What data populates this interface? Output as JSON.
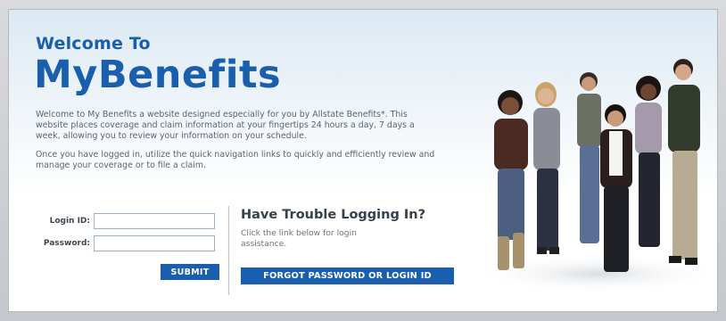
{
  "header": {
    "welcome_line": "Welcome To",
    "brand": "MyBenefits"
  },
  "intro": {
    "paragraph1": "Welcome to My Benefits a website designed especially for you by Allstate Benefits*. This website places coverage and claim information at your fingertips 24 hours a day, 7 days a week, allowing you to review your information on your schedule.",
    "paragraph2": "Once you have logged in, utilize the quick navigation links to quickly and efficiently review and manage your coverage or to file a claim."
  },
  "login": {
    "login_id_label": "Login ID:",
    "login_id_value": "",
    "password_label": "Password:",
    "password_value": "",
    "submit_label": "SUBMIT"
  },
  "trouble": {
    "title": "Have Trouble Logging In?",
    "help_text": "Click the link below for login assistance.",
    "forgot_label": "FORGOT PASSWORD OR LOGIN ID"
  },
  "colors": {
    "brand_blue": "#1a5fad",
    "text_gray": "#5a6470",
    "frame_gray": "#c9ccd0"
  },
  "photo": {
    "icon": "group-of-people-photo"
  }
}
